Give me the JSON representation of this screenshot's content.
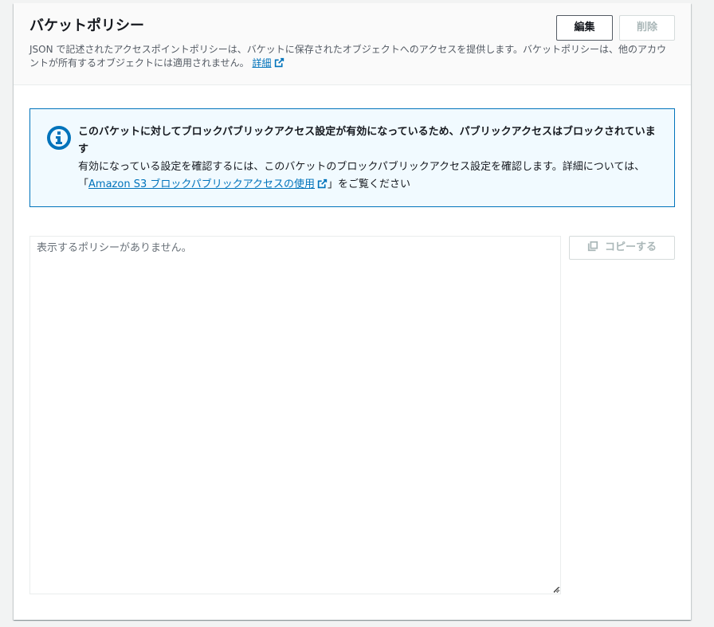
{
  "header": {
    "title": "バケットポリシー",
    "description": "JSON で記述されたアクセスポイントポリシーは、バケットに保存されたオブジェクトへのアクセスを提供します。バケットポリシーは、他のアカウントが所有するオブジェクトには適用されません。",
    "learn_more": "詳細",
    "edit_label": "編集",
    "delete_label": "削除"
  },
  "alert": {
    "title": "このバケットに対してブロックパブリックアクセス設定が有効になっているため、パブリックアクセスはブロックされています",
    "body_prefix": "有効になっている設定を確認するには、このバケットのブロックパブリックアクセス設定を確認します。詳細については、「",
    "body_link": "Amazon S3 ブロックパブリックアクセスの使用",
    "body_suffix": "」をご覧ください"
  },
  "policy": {
    "empty_text": "表示するポリシーがありません。",
    "copy_label": "コピーする"
  },
  "colors": {
    "link": "#0073bb",
    "info_bg": "#f1faff",
    "info_border": "#0073bb",
    "disabled_text": "#aab7b8"
  }
}
